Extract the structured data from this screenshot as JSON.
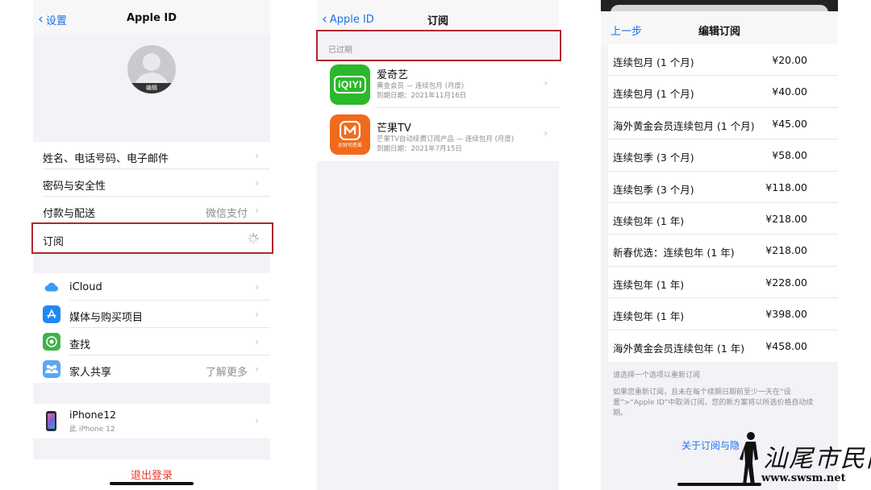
{
  "screen1": {
    "back_label": "设置",
    "title": "Apple ID",
    "avatar_edit": "编辑",
    "rows_group1": [
      {
        "label": "姓名、电话号码、电子邮件",
        "value": ""
      },
      {
        "label": "密码与安全性",
        "value": ""
      },
      {
        "label": "付款与配送",
        "value": "微信支付"
      },
      {
        "label": "订阅",
        "value": ""
      }
    ],
    "rows_group2": [
      {
        "label": "iCloud",
        "value": "",
        "icon": "cloud-icon",
        "color": "#3d9af5"
      },
      {
        "label": "媒体与购买项目",
        "value": "",
        "icon": "app-store-icon",
        "color": "#1e88f5"
      },
      {
        "label": "查找",
        "value": "",
        "icon": "find-my-icon",
        "color": "#3fb24c"
      },
      {
        "label": "家人共享",
        "value": "了解更多",
        "icon": "family-icon",
        "color": "#5aa8f5"
      }
    ],
    "device": {
      "name": "iPhone12",
      "sub": "此 iPhone 12"
    },
    "sign_out": "退出登录"
  },
  "screen2": {
    "back_label": "Apple ID",
    "title": "订阅",
    "section_header": "已过期",
    "apps": [
      {
        "name": "爱奇艺",
        "plan": "黄金会员 — 连续包月 (月度)",
        "expiry": "到期日期：2021年11月16日",
        "icon_text": "iQIYI",
        "color": "#2cb82c"
      },
      {
        "name": "芒果TV",
        "plan": "芒果TV自动续费订阅产品 — 连续包月 (月度)",
        "expiry": "到期日期：2021年7月15日",
        "icon_text": "女财何恶爱",
        "color": "#f26a1c"
      }
    ]
  },
  "screen3": {
    "back_label": "上一步",
    "title": "编辑订阅",
    "options": [
      {
        "label": "连续包月 (1 个月)",
        "price": "¥20.00"
      },
      {
        "label": "连续包月 (1 个月)",
        "price": "¥40.00"
      },
      {
        "label": "海外黄金会员连续包月 (1 个月)",
        "price": "¥45.00"
      },
      {
        "label": "连续包季 (3 个月)",
        "price": "¥58.00"
      },
      {
        "label": "连续包季 (3 个月)",
        "price": "¥118.00"
      },
      {
        "label": "连续包年 (1 年)",
        "price": "¥218.00"
      },
      {
        "label": "新春优选：连续包年 (1 年)",
        "price": "¥218.00"
      },
      {
        "label": "连续包年 (1 年)",
        "price": "¥228.00"
      },
      {
        "label": "连续包年 (1 年)",
        "price": "¥398.00"
      },
      {
        "label": "海外黄金会员连续包年 (1 年)",
        "price": "¥458.00"
      }
    ],
    "note_title": "请选择一个选项以重新订阅",
    "note_body": "如果您重新订阅，且未在每个续期日期前至少一天在“设置”>“Apple ID”中取消订阅，您的新方案将以所选价格自动续期。",
    "about_link": "关于订阅与隐"
  },
  "watermark": {
    "text": "汕尾市民网",
    "url": "www.swsm.net"
  },
  "colors": {
    "accent": "#1a73e8",
    "highlight": "#b3262c",
    "danger": "#e03b2f"
  }
}
